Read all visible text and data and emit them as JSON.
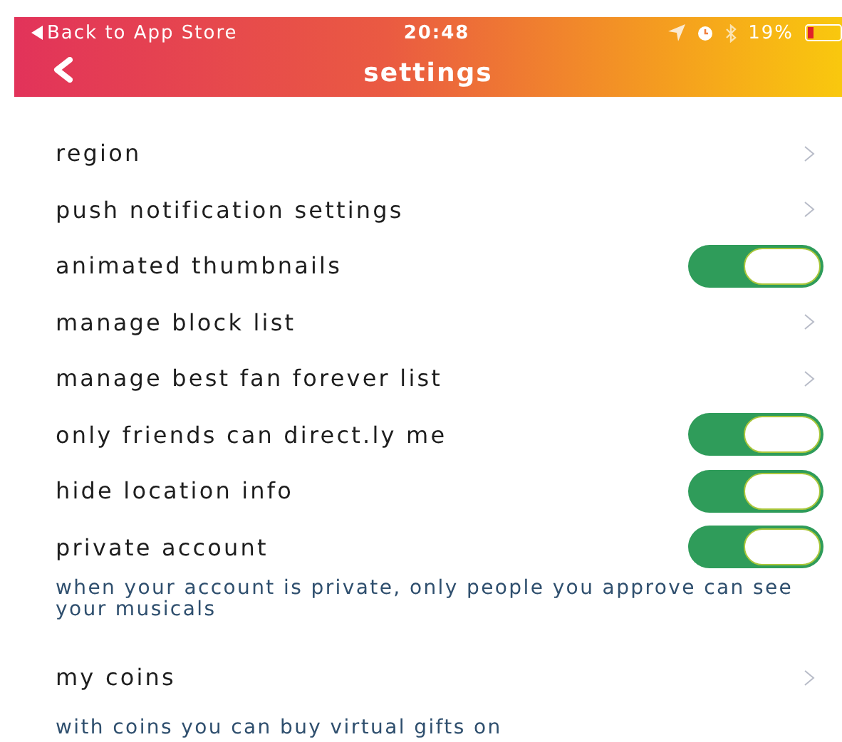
{
  "status_bar": {
    "back_label": "Back to App Store",
    "time": "20:48",
    "battery": "19%"
  },
  "header": {
    "title": "settings"
  },
  "rows": [
    {
      "kind": "link",
      "label": "region"
    },
    {
      "kind": "link",
      "label": "push notification settings"
    },
    {
      "kind": "toggle",
      "label": "animated thumbnails",
      "on": true
    },
    {
      "kind": "link",
      "label": "manage block list"
    },
    {
      "kind": "link",
      "label": "manage best fan forever list"
    },
    {
      "kind": "toggle",
      "label": "only friends can direct.ly me",
      "on": true
    },
    {
      "kind": "toggle",
      "label": "hide location info",
      "on": true
    },
    {
      "kind": "toggle",
      "label": "private account",
      "on": true
    },
    {
      "kind": "note",
      "label": "when your account is private, only people you approve can see your musicals"
    },
    {
      "kind": "link",
      "label": "my coins"
    },
    {
      "kind": "note",
      "label": "with coins you can buy virtual gifts on"
    }
  ]
}
